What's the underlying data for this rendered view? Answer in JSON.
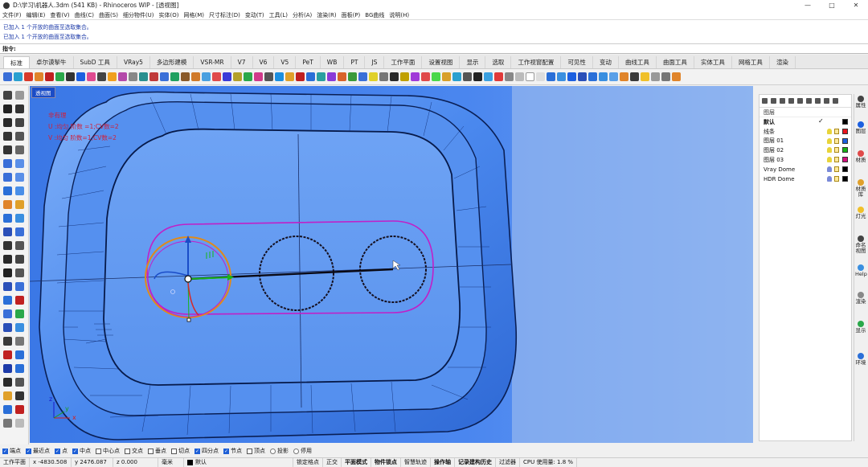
{
  "window": {
    "title": "D:\\学习\\机器人.3dm (541 KB) - Rhinoceros WIP - [透视图]",
    "controls": [
      "—",
      "□",
      "✕"
    ]
  },
  "menu": [
    "文件(F)",
    "编辑(E)",
    "查看(V)",
    "曲线(C)",
    "曲面(S)",
    "细分物件(U)",
    "实体(O)",
    "网格(M)",
    "尺寸标注(D)",
    "变动(T)",
    "工具(L)",
    "分析(A)",
    "渲染(R)",
    "面板(P)",
    "BG曲线",
    "说明(H)"
  ],
  "command_history": [
    "已加入 1 个开放的曲面至选取集合。",
    "已加入 1 个开放的曲面至选取集合。"
  ],
  "command_prompt": {
    "label": "指令:",
    "value": ""
  },
  "tabs": [
    "标准",
    "卓尔谟掣牛",
    "SubD 工具",
    "VRay5",
    "多边形建模",
    "VSR-MR",
    "V7",
    "V6",
    "V5",
    "PeT",
    "WB",
    "PT",
    "JS",
    "工作平面",
    "设置视图",
    "显示",
    "选取",
    "工作视窗配置",
    "可见性",
    "变动",
    "曲线工具",
    "曲面工具",
    "实体工具",
    "网格工具",
    "渲染"
  ],
  "active_tab": "标准",
  "viewport": {
    "label": "透视图",
    "annotation": {
      "line1": "非有理",
      "line2": "U :均匀  阶数 =1;CV数=2",
      "line3": "V :均匀  阶数=1;CV数=2"
    },
    "axes": {
      "x": "x",
      "y": "y",
      "z": "z"
    }
  },
  "layers_panel": {
    "header": "图层",
    "layers": [
      {
        "name": "默认",
        "color": "#000000",
        "current": true
      },
      {
        "name": "线条",
        "color": "#e8141c"
      },
      {
        "name": "图层 01",
        "color": "#1c5fe0"
      },
      {
        "name": "图层 02",
        "color": "#16b216"
      },
      {
        "name": "图层 03",
        "color": "#d40f7d"
      },
      {
        "name": "Vray Dome",
        "color": "#000000"
      },
      {
        "name": "HDR Dome",
        "color": "#000000"
      }
    ]
  },
  "side_tabs": [
    "属性",
    "图层",
    "材质",
    "材质库",
    "灯光",
    "命名视图",
    "Help",
    "渲染",
    "显示",
    "环境"
  ],
  "osnaps": [
    {
      "label": "端点",
      "on": true
    },
    {
      "label": "最近点",
      "on": true
    },
    {
      "label": "点",
      "on": true
    },
    {
      "label": "中点",
      "on": true
    },
    {
      "label": "中心点",
      "on": false
    },
    {
      "label": "交点",
      "on": false
    },
    {
      "label": "垂点",
      "on": false
    },
    {
      "label": "切点",
      "on": false
    },
    {
      "label": "四分点",
      "on": true
    },
    {
      "label": "节点",
      "on": true
    },
    {
      "label": "顶点",
      "on": false
    }
  ],
  "osnap_radios": [
    "投影",
    "停用"
  ],
  "status": {
    "cplane": "工作平面",
    "x": "x -4830.508",
    "y": "y 2476.087",
    "z": "z 0.000",
    "units": "毫米",
    "layer": "默认",
    "toggles": [
      "锁定格点",
      "正交",
      "平面模式",
      "物件锁点",
      "智慧轨迹",
      "操作轴",
      "记录建构历史",
      "过滤器"
    ],
    "cpu": "CPU 使用量: 1.8 %"
  }
}
